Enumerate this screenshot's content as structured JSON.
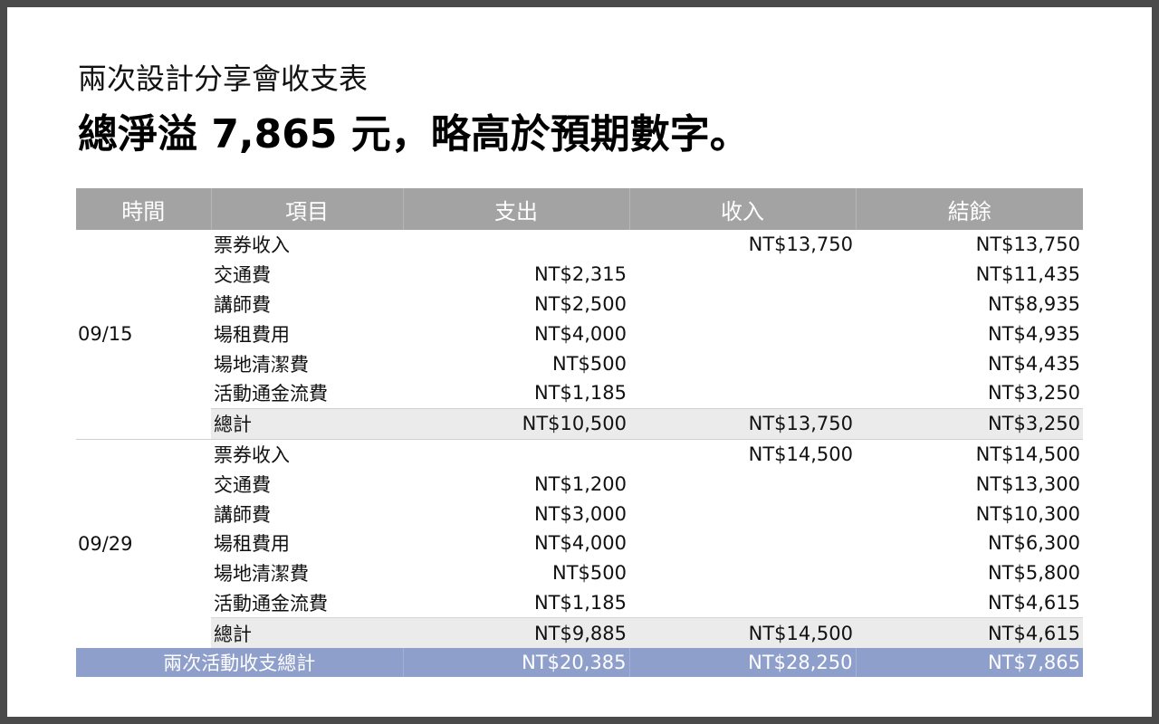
{
  "slide": {
    "subtitle": "兩次設計分享會收支表",
    "headline": "總淨溢 7,865 元，略高於預期數字。"
  },
  "table": {
    "headers": [
      "時間",
      "項目",
      "支出",
      "收入",
      "結餘"
    ],
    "groups": [
      {
        "date": "09/15",
        "rows": [
          {
            "item": "票券收入",
            "expense": "",
            "income": "NT$13,750",
            "balance": "NT$13,750"
          },
          {
            "item": "交通費",
            "expense": "NT$2,315",
            "income": "",
            "balance": "NT$11,435"
          },
          {
            "item": "講師費",
            "expense": "NT$2,500",
            "income": "",
            "balance": "NT$8,935"
          },
          {
            "item": "場租費用",
            "expense": "NT$4,000",
            "income": "",
            "balance": "NT$4,935"
          },
          {
            "item": "場地清潔費",
            "expense": "NT$500",
            "income": "",
            "balance": "NT$4,435"
          },
          {
            "item": "活動通金流費",
            "expense": "NT$1,185",
            "income": "",
            "balance": "NT$3,250"
          }
        ],
        "subtotal": {
          "item": "總計",
          "expense": "NT$10,500",
          "income": "NT$13,750",
          "balance": "NT$3,250"
        }
      },
      {
        "date": "09/29",
        "rows": [
          {
            "item": "票券收入",
            "expense": "",
            "income": "NT$14,500",
            "balance": "NT$14,500"
          },
          {
            "item": "交通費",
            "expense": "NT$1,200",
            "income": "",
            "balance": "NT$13,300"
          },
          {
            "item": "講師費",
            "expense": "NT$3,000",
            "income": "",
            "balance": "NT$10,300"
          },
          {
            "item": "場租費用",
            "expense": "NT$4,000",
            "income": "",
            "balance": "NT$6,300"
          },
          {
            "item": "場地清潔費",
            "expense": "NT$500",
            "income": "",
            "balance": "NT$5,800"
          },
          {
            "item": "活動通金流費",
            "expense": "NT$1,185",
            "income": "",
            "balance": "NT$4,615"
          }
        ],
        "subtotal": {
          "item": "總計",
          "expense": "NT$9,885",
          "income": "NT$14,500",
          "balance": "NT$4,615"
        }
      }
    ],
    "grand_total": {
      "label": "兩次活動收支總計",
      "expense": "NT$20,385",
      "income": "NT$28,250",
      "balance": "NT$7,865"
    }
  }
}
